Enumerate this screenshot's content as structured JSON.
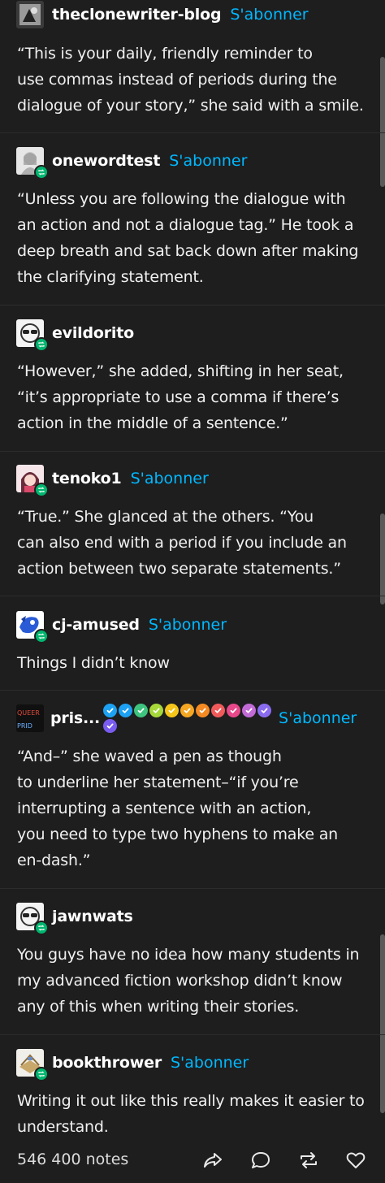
{
  "posts": [
    {
      "username": "theclonewriter-blog",
      "follow": "S'abonner",
      "lines": [
        "“This is your daily, friendly reminder to",
        "use commas instead of periods during the",
        "dialogue of your story,” she said with a smile."
      ]
    },
    {
      "username": "onewordtest",
      "follow": "S'abonner",
      "lines": [
        "“Unless you are following the dialogue with",
        "an action and not a dialogue tag.” He took a",
        "deep breath and sat back down after making",
        "the clarifying statement."
      ]
    },
    {
      "username": "evildorito",
      "follow": "",
      "lines": [
        "“However,” she added, shifting in her seat,",
        "“it’s appropriate to use a comma if there’s",
        "action in the middle of a sentence.”"
      ]
    },
    {
      "username": "tenoko1",
      "follow": "S'abonner",
      "lines": [
        "“True.” She glanced at the others. “You",
        "can also end with a period if you include an",
        "action between two separate statements.”"
      ]
    },
    {
      "username": "cj-amused",
      "follow": "S'abonner",
      "lines": [
        "Things I didn’t know"
      ]
    },
    {
      "username": "pris...",
      "follow": "S'abonner",
      "avatar_text": "QUEER",
      "lines": [
        "“And–” she waved a pen as though",
        "to underline her statement–“if you’re",
        "interrupting a sentence with an action,",
        "you need to type two hyphens to make an",
        "en-dash.”"
      ]
    },
    {
      "username": "jawnwats",
      "follow": "",
      "lines": [
        "You guys have no idea how many students in",
        "my advanced fiction workshop didn’t know",
        "any of this when writing their stories."
      ]
    },
    {
      "username": "bookthrower",
      "follow": "S'abonner",
      "lines": [
        "Writing it out like this really makes it easier to",
        "understand."
      ]
    }
  ],
  "badge_colors": [
    "#1da1f2",
    "#1da1f2",
    "#3ec47e",
    "#a6d83a",
    "#f5c518",
    "#f5a623",
    "#f58a23",
    "#f05a5a",
    "#e8488a",
    "#c26bd6",
    "#8a6cf0",
    "#7a5cf0"
  ],
  "footer": {
    "notes": "546 400 notes"
  },
  "colors": {
    "background": "#1e1e1e",
    "accent": "#00b8ff",
    "reblog_badge": "#00b66f"
  }
}
